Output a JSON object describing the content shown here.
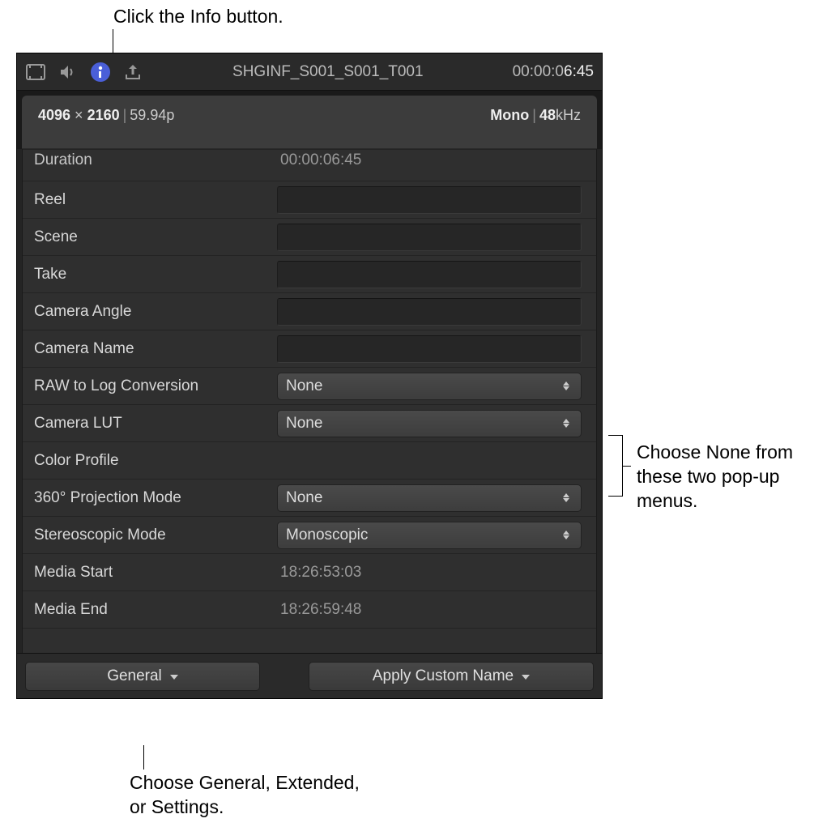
{
  "annotations": {
    "top": "Click the Info button.",
    "right": "Choose None from these two pop-up menus.",
    "bottom": "Choose General, Extended, or Settings."
  },
  "toolbar": {
    "clip_name": "SHGINF_S001_S001_T001",
    "timecode_prefix": "00:00:0",
    "timecode_end": "6:45"
  },
  "format": {
    "width": "4096",
    "height": "2160",
    "fps": "59.94p",
    "audio_channels": "Mono",
    "audio_rate_value": "48",
    "audio_rate_unit": "kHz"
  },
  "fields": {
    "duration": {
      "label": "Duration",
      "value": "00:00:06:45"
    },
    "reel": {
      "label": "Reel"
    },
    "scene": {
      "label": "Scene"
    },
    "take": {
      "label": "Take"
    },
    "camera_angle": {
      "label": "Camera Angle"
    },
    "camera_name": {
      "label": "Camera Name"
    },
    "raw_to_log": {
      "label": "RAW to Log Conversion",
      "value": "None"
    },
    "camera_lut": {
      "label": "Camera LUT",
      "value": "None"
    },
    "color_profile": {
      "label": "Color Profile"
    },
    "projection_mode": {
      "label": "360° Projection Mode",
      "value": "None"
    },
    "stereoscopic": {
      "label": "Stereoscopic Mode",
      "value": "Monoscopic"
    },
    "media_start": {
      "label": "Media Start",
      "value": "18:26:53:03"
    },
    "media_end": {
      "label": "Media End",
      "value": "18:26:59:48"
    }
  },
  "bottom": {
    "view_label": "General",
    "apply_label": "Apply Custom Name"
  }
}
